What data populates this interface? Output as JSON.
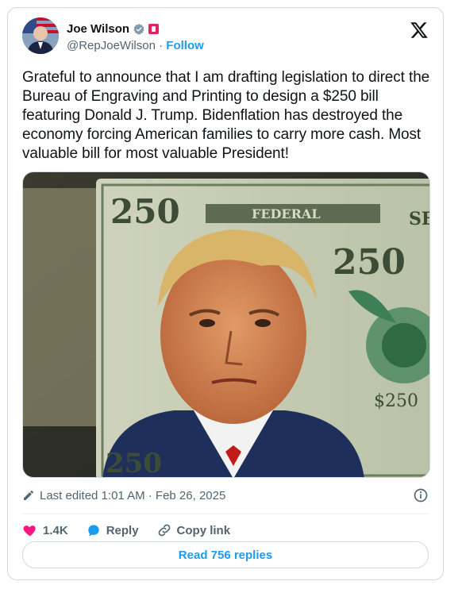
{
  "author": {
    "name": "Joe Wilson",
    "handle": "@RepJoeWilson",
    "separator": "·",
    "follow_label": "Follow"
  },
  "tweet_text": "Grateful to announce that I am drafting legislation to direct the Bureau of Engraving and Printing to design a $250 bill featuring Donald J. Trump. Bidenflation has destroyed the economy forcing American families to carry more cash. Most valuable bill for most valuable President!",
  "media": {
    "denomination_text": "250",
    "banner_text": "FEDERAL",
    "side_text": "SE",
    "small_value": "$250"
  },
  "meta": {
    "edited_label": "Last edited 1:01 AM · Feb 26, 2025"
  },
  "actions": {
    "likes": "1.4K",
    "reply_label": "Reply",
    "copy_label": "Copy link"
  },
  "read_replies_label": "Read 756 replies",
  "colors": {
    "accent": "#1d9bf0",
    "like": "#f91880",
    "text": "#0f1419",
    "muted": "#536471",
    "border": "#cfd9de"
  },
  "icons": [
    "verified-badge-icon",
    "flag-icon",
    "x-logo-icon",
    "pencil-icon",
    "info-icon",
    "heart-icon",
    "reply-icon",
    "link-icon"
  ]
}
